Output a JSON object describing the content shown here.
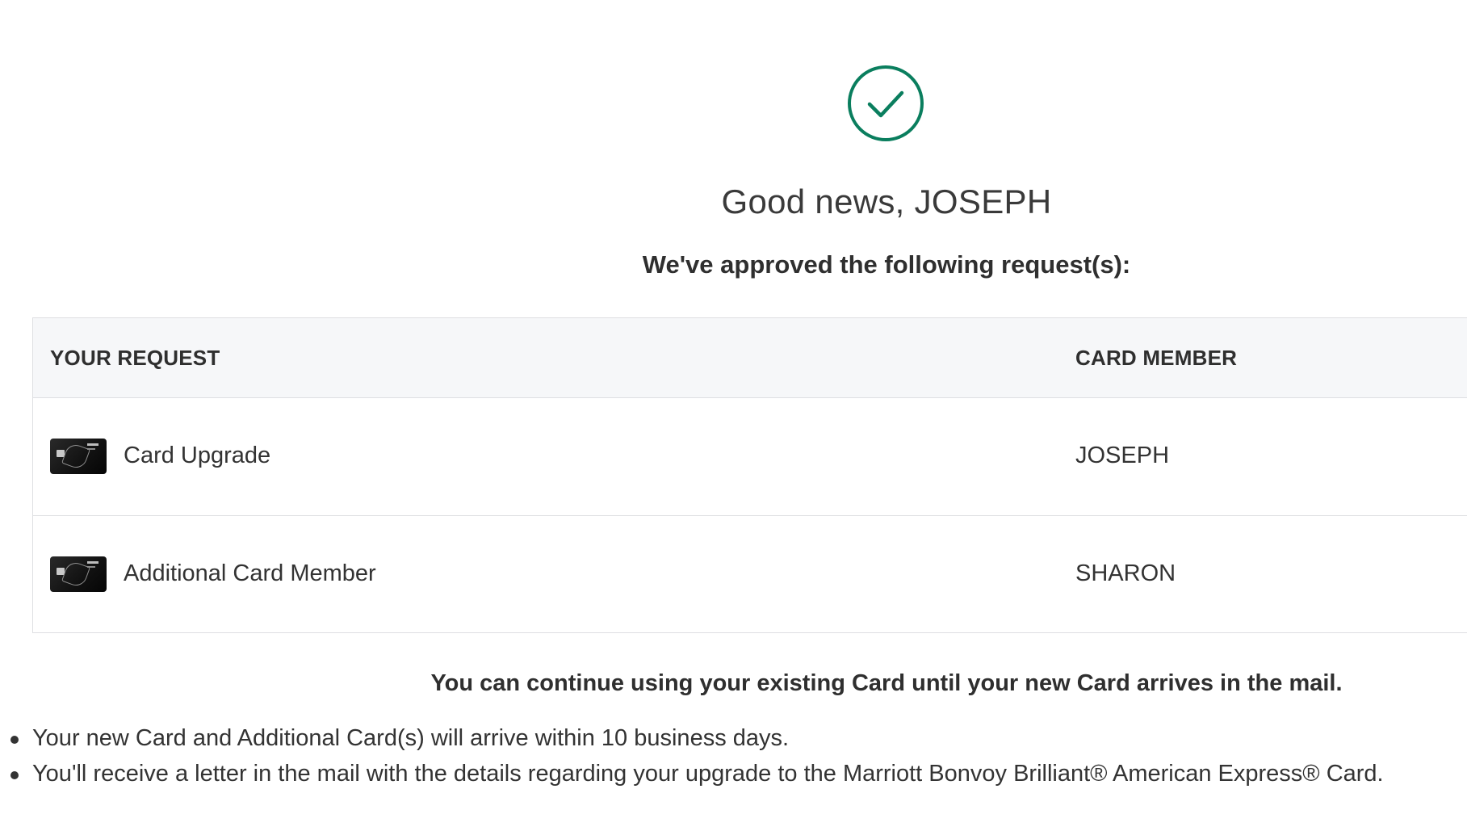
{
  "header": {
    "greeting": "Good news, JOSEPH",
    "approved_text": "We've approved the following request(s):",
    "status_icon": "check-circle-icon",
    "status_color": "#0a7e5e"
  },
  "table": {
    "columns": [
      "YOUR REQUEST",
      "CARD MEMBER"
    ],
    "rows": [
      {
        "request": "Card Upgrade",
        "member": "JOSEPH",
        "icon": "card-icon"
      },
      {
        "request": "Additional Card Member",
        "member": "SHARON",
        "icon": "card-icon"
      }
    ]
  },
  "note": "You can continue using your existing Card until your new Card arrives in the mail.",
  "bullets": [
    "Your new Card and Additional Card(s) will arrive within 10 business days.",
    "You'll receive a letter in the mail with the details regarding your upgrade to the Marriott Bonvoy Brilliant® American Express® Card."
  ]
}
